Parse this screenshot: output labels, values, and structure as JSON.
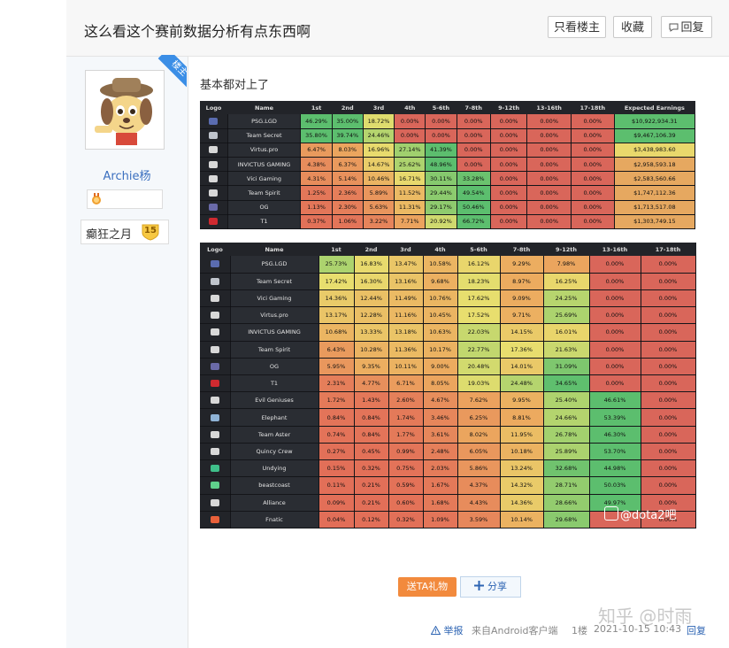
{
  "header": {
    "title": "这么看这个赛前数据分析有点东西啊",
    "btn_op_only": "只看楼主",
    "btn_collect": "收藏",
    "btn_reply": "回复"
  },
  "author": {
    "ribbon": "楼主",
    "name": "Archie杨",
    "level_name": "癫狂之月",
    "level_num": "15"
  },
  "post": {
    "text": "基本都对上了",
    "gift_label": "送TA礼物",
    "share_label": "分享"
  },
  "table1": {
    "headers": [
      "Logo",
      "Name",
      "1st",
      "2nd",
      "3rd",
      "4th",
      "5-6th",
      "7-8th",
      "9-12th",
      "13-16th",
      "17-18th",
      "Expected Earnings"
    ],
    "rows": [
      {
        "name": "PSG.LGD",
        "vals": [
          "46.29%",
          "35.00%",
          "18.72%",
          "0.00%",
          "0.00%",
          "0.00%",
          "0.00%",
          "0.00%",
          "0.00%",
          "$10,922,934.31"
        ],
        "logo": "#5a6cb0"
      },
      {
        "name": "Team Secret",
        "vals": [
          "35.80%",
          "39.74%",
          "24.46%",
          "0.00%",
          "0.00%",
          "0.00%",
          "0.00%",
          "0.00%",
          "0.00%",
          "$9,467,106.39"
        ],
        "logo": "#bfc4cc"
      },
      {
        "name": "Virtus.pro",
        "vals": [
          "6.47%",
          "8.03%",
          "16.96%",
          "27.14%",
          "41.39%",
          "0.00%",
          "0.00%",
          "0.00%",
          "0.00%",
          "$3,438,983.60"
        ],
        "logo": "#d8d8d8"
      },
      {
        "name": "INVICTUS GAMING",
        "vals": [
          "4.38%",
          "6.37%",
          "14.67%",
          "25.62%",
          "48.96%",
          "0.00%",
          "0.00%",
          "0.00%",
          "0.00%",
          "$2,958,593.18"
        ],
        "logo": "#d8d8d8"
      },
      {
        "name": "Vici Gaming",
        "vals": [
          "4.31%",
          "5.14%",
          "10.46%",
          "16.71%",
          "30.11%",
          "33.28%",
          "0.00%",
          "0.00%",
          "0.00%",
          "$2,583,560.66"
        ],
        "logo": "#d8d8d8"
      },
      {
        "name": "Team Spirit",
        "vals": [
          "1.25%",
          "2.36%",
          "5.89%",
          "11.52%",
          "29.44%",
          "49.54%",
          "0.00%",
          "0.00%",
          "0.00%",
          "$1,747,112.36"
        ],
        "logo": "#d8d8d8"
      },
      {
        "name": "OG",
        "vals": [
          "1.13%",
          "2.30%",
          "5.63%",
          "11.31%",
          "29.17%",
          "50.46%",
          "0.00%",
          "0.00%",
          "0.00%",
          "$1,713,517.08"
        ],
        "logo": "#6a6aa8"
      },
      {
        "name": "T1",
        "vals": [
          "0.37%",
          "1.06%",
          "3.22%",
          "7.71%",
          "20.92%",
          "66.72%",
          "0.00%",
          "0.00%",
          "0.00%",
          "$1,303,749.15"
        ],
        "logo": "#d02a30"
      }
    ]
  },
  "table2": {
    "headers": [
      "Logo",
      "Name",
      "1st",
      "2nd",
      "3rd",
      "4th",
      "5-6th",
      "7-8th",
      "9-12th",
      "13-16th",
      "17-18th"
    ],
    "rows": [
      {
        "name": "PSG.LGD",
        "vals": [
          "25.73%",
          "16.83%",
          "13.47%",
          "10.58%",
          "16.12%",
          "9.29%",
          "7.98%",
          "0.00%",
          "0.00%"
        ],
        "logo": "#5a6cb0"
      },
      {
        "name": "Team Secret",
        "vals": [
          "17.42%",
          "16.30%",
          "13.16%",
          "9.68%",
          "18.23%",
          "8.97%",
          "16.25%",
          "0.00%",
          "0.00%"
        ],
        "logo": "#bfc4cc"
      },
      {
        "name": "Vici Gaming",
        "vals": [
          "14.36%",
          "12.44%",
          "11.49%",
          "10.76%",
          "17.62%",
          "9.09%",
          "24.25%",
          "0.00%",
          "0.00%"
        ],
        "logo": "#d8d8d8"
      },
      {
        "name": "Virtus.pro",
        "vals": [
          "13.17%",
          "12.28%",
          "11.16%",
          "10.45%",
          "17.52%",
          "9.71%",
          "25.69%",
          "0.00%",
          "0.00%"
        ],
        "logo": "#d8d8d8"
      },
      {
        "name": "INVICTUS GAMING",
        "vals": [
          "10.68%",
          "13.33%",
          "13.18%",
          "10.63%",
          "22.03%",
          "14.15%",
          "16.01%",
          "0.00%",
          "0.00%"
        ],
        "logo": "#d8d8d8"
      },
      {
        "name": "Team Spirit",
        "vals": [
          "6.43%",
          "10.28%",
          "11.36%",
          "10.17%",
          "22.77%",
          "17.36%",
          "21.63%",
          "0.00%",
          "0.00%"
        ],
        "logo": "#d8d8d8"
      },
      {
        "name": "OG",
        "vals": [
          "5.95%",
          "9.35%",
          "10.11%",
          "9.00%",
          "20.48%",
          "14.01%",
          "31.09%",
          "0.00%",
          "0.00%"
        ],
        "logo": "#6a6aa8"
      },
      {
        "name": "T1",
        "vals": [
          "2.31%",
          "4.77%",
          "6.71%",
          "8.05%",
          "19.03%",
          "24.48%",
          "34.65%",
          "0.00%",
          "0.00%"
        ],
        "logo": "#d02a30"
      },
      {
        "name": "Evil Geniuses",
        "vals": [
          "1.72%",
          "1.43%",
          "2.60%",
          "4.67%",
          "7.62%",
          "9.95%",
          "25.40%",
          "46.61%",
          "0.00%"
        ],
        "logo": "#d8d8d8"
      },
      {
        "name": "Elephant",
        "vals": [
          "0.84%",
          "0.84%",
          "1.74%",
          "3.46%",
          "6.25%",
          "8.81%",
          "24.66%",
          "53.39%",
          "0.00%"
        ],
        "logo": "#8fb3d6"
      },
      {
        "name": "Team Aster",
        "vals": [
          "0.74%",
          "0.84%",
          "1.77%",
          "3.61%",
          "8.02%",
          "11.95%",
          "26.78%",
          "46.30%",
          "0.00%"
        ],
        "logo": "#d8d8d8"
      },
      {
        "name": "Quincy Crew",
        "vals": [
          "0.27%",
          "0.45%",
          "0.99%",
          "2.48%",
          "6.05%",
          "10.18%",
          "25.89%",
          "53.70%",
          "0.00%"
        ],
        "logo": "#d8d8d8"
      },
      {
        "name": "Undying",
        "vals": [
          "0.15%",
          "0.32%",
          "0.75%",
          "2.03%",
          "5.86%",
          "13.24%",
          "32.68%",
          "44.98%",
          "0.00%"
        ],
        "logo": "#3fbf8a"
      },
      {
        "name": "beastcoast",
        "vals": [
          "0.11%",
          "0.21%",
          "0.59%",
          "1.67%",
          "4.37%",
          "14.32%",
          "28.71%",
          "50.03%",
          "0.00%"
        ],
        "logo": "#5fd08c"
      },
      {
        "name": "Alliance",
        "vals": [
          "0.09%",
          "0.21%",
          "0.60%",
          "1.68%",
          "4.43%",
          "14.36%",
          "28.66%",
          "49.97%",
          "0.00%"
        ],
        "logo": "#d8d8d8"
      },
      {
        "name": "Fnatic",
        "vals": [
          "0.04%",
          "0.12%",
          "0.32%",
          "1.09%",
          "3.59%",
          "10.14%",
          "29.68%",
          "",
          "0.00%"
        ],
        "logo": "#e8603a"
      }
    ]
  },
  "watermark": {
    "tieba": "@dota2吧",
    "zhihu": "知乎 @时雨"
  },
  "footer": {
    "report": "举报",
    "source": "来自Android客户端",
    "floor": "1楼",
    "time": "2021-10-15 10:43",
    "reply": "回复"
  }
}
